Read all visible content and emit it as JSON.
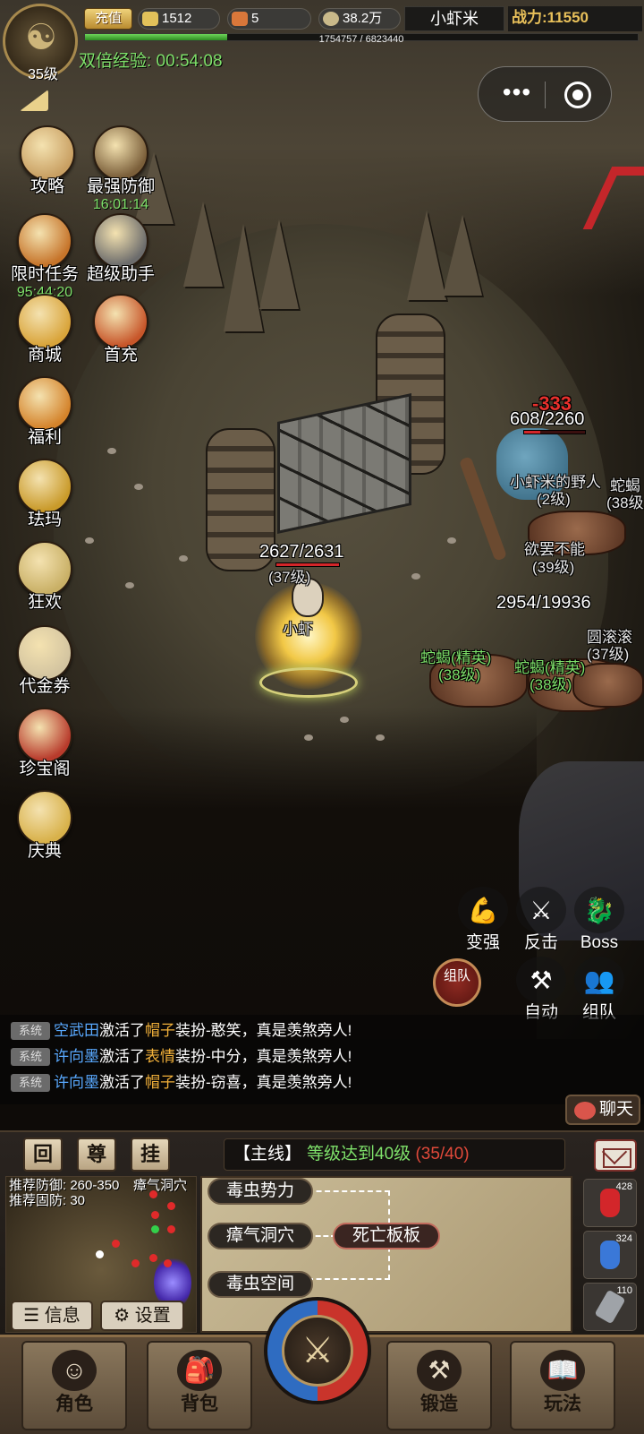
{
  "top_bar": {
    "recharge_label": "充值",
    "gold": "1512",
    "item": "5",
    "coins": "38.2万",
    "player_name": "小虾米",
    "power_label": "战力:",
    "power_value": "11550",
    "exp_text": "1754757 / 6823440",
    "exp_fraction": 0.257
  },
  "avatar": {
    "level": "35级"
  },
  "double_exp": "双倍经验: 00:54:08",
  "left_menu": [
    {
      "label": "攻略",
      "icon": "scroll-icon"
    },
    {
      "label": "最强防御",
      "timer": "16:01:14",
      "icon": "warrior-icon"
    },
    {
      "label": "限时任务",
      "timer": "95:44:20",
      "icon": "hourglass-icon"
    },
    {
      "label": "超级助手",
      "icon": "wrench-icon"
    },
    {
      "label": "商城",
      "icon": "shop-icon"
    },
    {
      "label": "首充",
      "icon": "treasure-icon"
    },
    {
      "label": "福利",
      "icon": "bag-icon"
    },
    {
      "label": "珐玛",
      "icon": "lion-icon"
    },
    {
      "label": "狂欢",
      "icon": "carnival-icon"
    },
    {
      "label": "代金券",
      "icon": "voucher-icon"
    },
    {
      "label": "珍宝阁",
      "icon": "pavilion-icon"
    },
    {
      "label": "庆典",
      "icon": "trumpet-icon"
    }
  ],
  "world": {
    "player_hp": "2627/2631",
    "player_hp_fraction": 0.998,
    "player_level": "(37级)",
    "player_tag": "小虾",
    "damage": "-333",
    "ogre_hp": "608/2260",
    "ogre_hp_fraction": 0.27,
    "ogre_name": "小虾米的野人",
    "ogre_level": "(2级)",
    "right_name": "蛇蝎",
    "right_level": "(38级",
    "boss_name": "欲罢不能",
    "boss_level": "(39级)",
    "boss_hp": "2954/19936",
    "elite1_name": "蛇蝎(精英)",
    "elite1_level": "(38级)",
    "elite2_name": "蛇蝎(精英)",
    "elite2_level": "(38级)",
    "roll_name": "圆滚滚",
    "roll_level": "(37级)"
  },
  "actions": {
    "strengthen": "变强",
    "counter": "反击",
    "boss": "Boss",
    "auto": "自动",
    "team": "组队",
    "team_bubble": "组队"
  },
  "chat": {
    "tag": "系统",
    "lines": [
      {
        "name": "空武田",
        "mid": "激活了",
        "item": "帽子",
        "rest": "装扮-憨笑，真是羡煞旁人!"
      },
      {
        "name": "许向墨",
        "mid": "激活了",
        "item": "表情",
        "rest": "装扮-中分，真是羡煞旁人!"
      },
      {
        "name": "许向墨",
        "mid": "激活了",
        "item": "帽子",
        "rest": "装扮-窃喜，真是羡煞旁人!"
      }
    ],
    "chat_button": "聊天"
  },
  "panel": {
    "btn_return": "回",
    "btn_honor": "尊",
    "btn_idle": "挂",
    "quest_tag": "【主线】",
    "quest_text": "等级达到40级",
    "quest_progress": "(35/40)",
    "minimap_def": "推荐防御: 260-350",
    "minimap_fixed": "推荐固防: 30",
    "minimap_zone": "瘴气洞穴",
    "info_btn": "信息",
    "settings_btn": "设置",
    "nodes": [
      "毒虫势力",
      "瘴气洞穴",
      "毒虫空间",
      "死亡板板"
    ],
    "potions": [
      "428",
      "324",
      "110"
    ]
  },
  "navbar": {
    "character": "角色",
    "bag": "背包",
    "forge": "锻造",
    "gameplay": "玩法"
  },
  "colors": {
    "exp_green": "#2f8d22",
    "hp_red": "#d3262a",
    "elite_green": "#7ee06a",
    "chat_name_blue": "#59a9ff",
    "chat_item_orange": "#f2b13a"
  }
}
